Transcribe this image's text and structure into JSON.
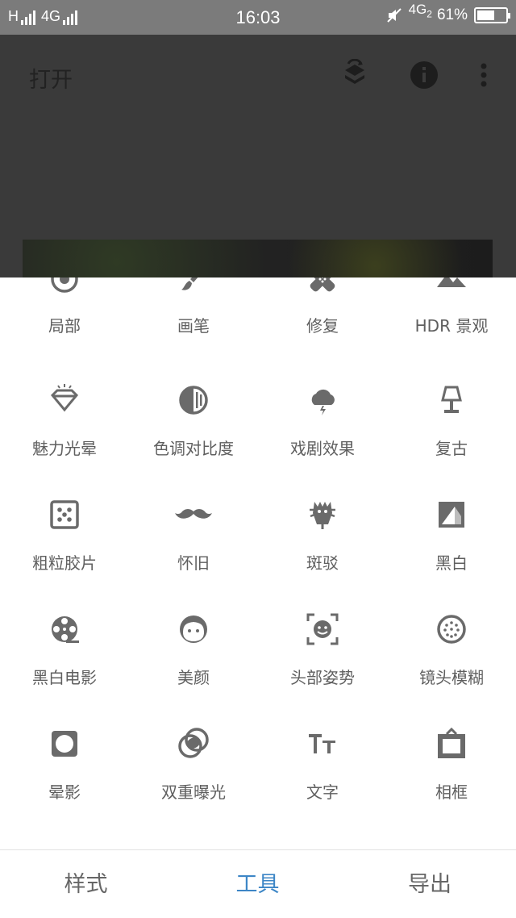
{
  "status_bar": {
    "network_left": "H",
    "network_mid": "4G",
    "time": "16:03",
    "network_right": "4G",
    "network_right_sub": "2",
    "battery_text": "61%",
    "battery_level": 0.61
  },
  "app_bar": {
    "title": "打开",
    "icons": [
      "layers-undo-icon",
      "info-icon",
      "more-vert-icon"
    ]
  },
  "tools": [
    {
      "label": "局部",
      "icon": "selective-icon"
    },
    {
      "label": "画笔",
      "icon": "brush-icon"
    },
    {
      "label": "修复",
      "icon": "healing-icon"
    },
    {
      "label": "HDR 景观",
      "icon": "hdr-landscape-icon"
    },
    {
      "label": "魅力光晕",
      "icon": "glamour-glow-icon"
    },
    {
      "label": "色调对比度",
      "icon": "tonal-contrast-icon"
    },
    {
      "label": "戏剧效果",
      "icon": "drama-icon"
    },
    {
      "label": "复古",
      "icon": "vintage-lamp-icon"
    },
    {
      "label": "粗粒胶片",
      "icon": "grainy-film-icon"
    },
    {
      "label": "怀旧",
      "icon": "mustache-icon"
    },
    {
      "label": "斑驳",
      "icon": "grunge-icon"
    },
    {
      "label": "黑白",
      "icon": "black-white-icon"
    },
    {
      "label": "黑白电影",
      "icon": "noir-film-reel-icon"
    },
    {
      "label": "美颜",
      "icon": "face-icon"
    },
    {
      "label": "头部姿势",
      "icon": "head-pose-icon"
    },
    {
      "label": "镜头模糊",
      "icon": "lens-blur-icon"
    },
    {
      "label": "晕影",
      "icon": "vignette-icon"
    },
    {
      "label": "双重曝光",
      "icon": "double-exposure-icon"
    },
    {
      "label": "文字",
      "icon": "text-icon"
    },
    {
      "label": "相框",
      "icon": "frames-icon"
    }
  ],
  "bottom_nav": {
    "tabs": [
      {
        "label": "样式",
        "active": false
      },
      {
        "label": "工具",
        "active": true
      },
      {
        "label": "导出",
        "active": false
      }
    ]
  },
  "colors": {
    "accent": "#3d86c6",
    "icon_gray": "#6a6a6a",
    "label_gray": "#5f5f5f",
    "status_bar": "#7b7b7b",
    "overlay": "#3a3a3a"
  }
}
